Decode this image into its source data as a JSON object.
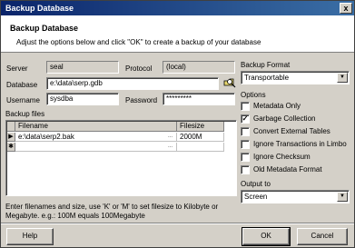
{
  "window": {
    "title": "Backup Database",
    "close_glyph": "x"
  },
  "header": {
    "title": "Backup Database",
    "subtitle": "Adjust the options below and click \"OK\" to create a backup of your database"
  },
  "connection": {
    "server_label": "Server",
    "server_value": "seal",
    "protocol_label": "Protocol",
    "protocol_value": "(local)",
    "database_label": "Database",
    "database_value": "e:\\data\\serp.gdb",
    "username_label": "Username",
    "username_value": "sysdba",
    "password_label": "Password",
    "password_value": "*********"
  },
  "backup_files": {
    "label": "Backup files",
    "columns": [
      "Filename",
      "Filesize"
    ],
    "rows": [
      {
        "filename": "e:\\data\\serp2.bak",
        "filesize": "2000M"
      }
    ],
    "current_row_glyph": "▶",
    "new_row_glyph": "✱",
    "ellipsis_glyph": "..."
  },
  "backup_format": {
    "label": "Backup Format",
    "selected": "Transportable"
  },
  "options": {
    "label": "Options",
    "items": [
      {
        "label": "Metadata Only",
        "checked": false
      },
      {
        "label": "Garbage Collection",
        "checked": true
      },
      {
        "label": "Convert External Tables",
        "checked": false
      },
      {
        "label": "Ignore Transactions in Limbo",
        "checked": false
      },
      {
        "label": "Ignore Checksum",
        "checked": false
      },
      {
        "label": "Old Metadata Format",
        "checked": false
      }
    ]
  },
  "output": {
    "label": "Output to",
    "selected": "Screen"
  },
  "hint": "Enter filenames and size, use 'K' or 'M' to set filesize to Kilobyte or Megabyte. e.g.: 100M equals 100Megabyte",
  "buttons": {
    "help": "Help",
    "ok": "OK",
    "cancel": "Cancel"
  },
  "icons": {
    "database_browse": "db-folder-icon"
  }
}
